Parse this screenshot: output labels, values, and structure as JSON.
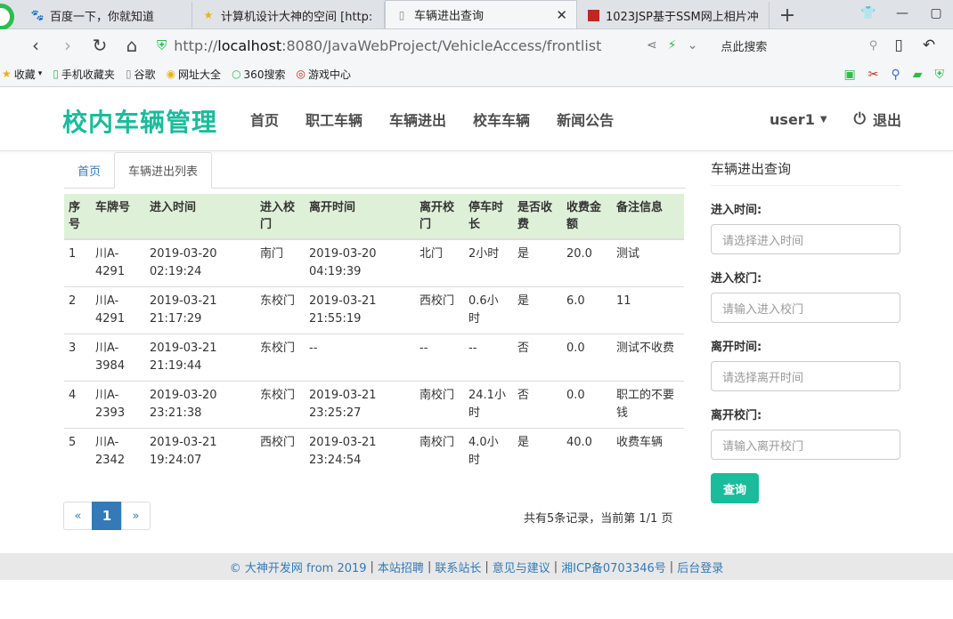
{
  "browser": {
    "tabs": [
      {
        "label": "百度一下，你就知道",
        "icon": "paw-icon"
      },
      {
        "label": "计算机设计大神的空间 [http:",
        "icon": "star-icon"
      },
      {
        "label": "车辆进出查询",
        "icon": "page-icon",
        "active": true
      },
      {
        "label": "1023JSP基于SSM网上相片冲",
        "icon": "red-square-icon"
      }
    ],
    "url_prefix": "http://",
    "url_host": "localhost",
    "url_rest": ":8080/JavaWebProject/VehicleAccess/frontlist",
    "search_text": "点此搜索",
    "bookmarks": [
      "收藏",
      "手机收藏夹",
      "谷歌",
      "网址大全",
      "360搜索",
      "游戏中心"
    ]
  },
  "site": {
    "brand": "校内车辆管理",
    "nav": [
      "首页",
      "职工车辆",
      "车辆进出",
      "校车车辆",
      "新闻公告"
    ],
    "user": "user1",
    "logout": "退出"
  },
  "page_tabs": [
    "首页",
    "车辆进出列表"
  ],
  "table": {
    "headers": [
      "序号",
      "车牌号",
      "进入时间",
      "进入校门",
      "离开时间",
      "离开校门",
      "停车时长",
      "是否收费",
      "收费金额",
      "备注信息"
    ],
    "rows": [
      [
        "1",
        "川A-4291",
        "2019-03-20 02:19:24",
        "南门",
        "2019-03-20 04:19:39",
        "北门",
        "2小时",
        "是",
        "20.0",
        "测试"
      ],
      [
        "2",
        "川A-4291",
        "2019-03-21 21:17:29",
        "东校门",
        "2019-03-21 21:55:19",
        "西校门",
        "0.6小时",
        "是",
        "6.0",
        "11"
      ],
      [
        "3",
        "川A-3984",
        "2019-03-21 21:19:44",
        "东校门",
        "--",
        "--",
        "--",
        "否",
        "0.0",
        "测试不收费"
      ],
      [
        "4",
        "川A-2393",
        "2019-03-20 23:21:38",
        "东校门",
        "2019-03-21 23:25:27",
        "南校门",
        "24.1小时",
        "否",
        "0.0",
        "职工的不要钱"
      ],
      [
        "5",
        "川A-2342",
        "2019-03-21 19:24:07",
        "西校门",
        "2019-03-21 23:24:54",
        "南校门",
        "4.0小时",
        "是",
        "40.0",
        "收费车辆"
      ]
    ]
  },
  "pagination": {
    "prev": "«",
    "current": "1",
    "next": "»",
    "info": "共有5条记录，当前第 1/1 页"
  },
  "sidebar": {
    "title": "车辆进出查询",
    "fields": [
      {
        "label": "进入时间:",
        "placeholder": "请选择进入时间"
      },
      {
        "label": "进入校门:",
        "placeholder": "请输入进入校门"
      },
      {
        "label": "离开时间:",
        "placeholder": "请选择离开时间"
      },
      {
        "label": "离开校门:",
        "placeholder": "请输入离开校门"
      }
    ],
    "button": "查询"
  },
  "footer": [
    "© 大神开发网 from 2019",
    "本站招聘",
    "联系站长",
    "意见与建议",
    "湘ICP备0703346号",
    "后台登录"
  ],
  "colors": {
    "accent": "#1abc9c",
    "link": "#337ab7",
    "table_header": "#dff0d8"
  }
}
